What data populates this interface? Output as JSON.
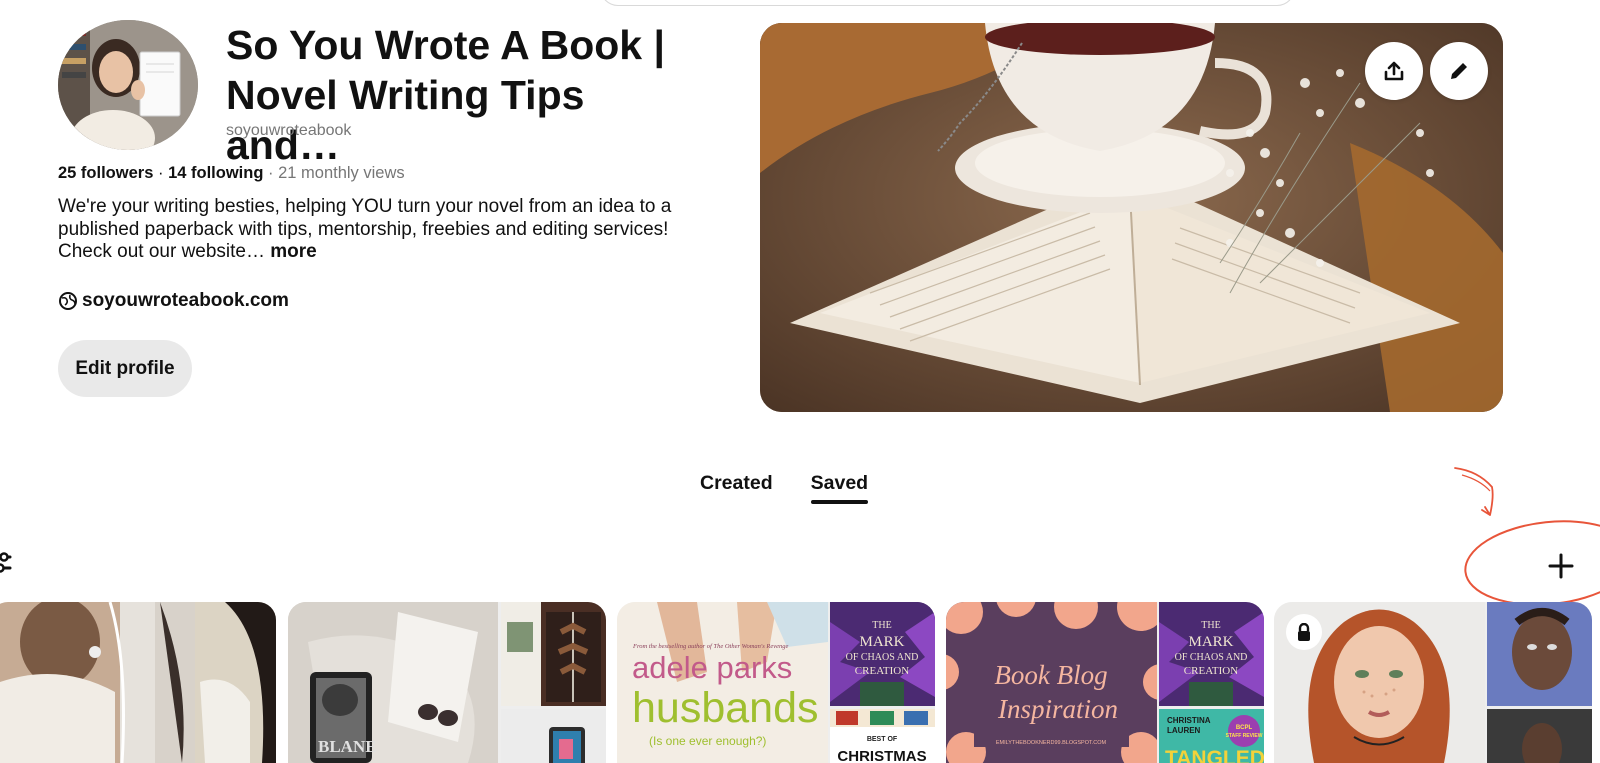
{
  "profile": {
    "name": "So You Wrote A Book | Novel Writing Tips and…",
    "username": "soyouwroteabook",
    "followers": "25 followers",
    "following": "14 following",
    "monthly_views": "21 monthly views",
    "bio": "We're your writing besties, helping YOU turn your novel from an idea to a published paperback with tips, mentorship, freebies and editing services! Check out our website…",
    "bio_more": "more",
    "website": "soyouwroteabook.com",
    "edit_label": "Edit profile"
  },
  "tabs": [
    {
      "label": "Created",
      "active": false
    },
    {
      "label": "Saved",
      "active": true
    }
  ],
  "board_text": {
    "husbands_author_line": "From the bestselling author of The Other Woman's Revenge",
    "husbands_author": "adele parks",
    "husbands_title": "husbands",
    "husbands_tagline": "(Is one ever enough?)",
    "blang": "BLANE",
    "mark_title": "THE MARK OF CHAOS AND CREATION",
    "best_of": "BEST OF",
    "christmas": "CHRISTMAS",
    "blog_title_1": "Book Blog",
    "blog_title_2": "Inspiration",
    "blog_url": "EMILYTHEBOOKNERD99.BLOGSPOT.COM",
    "christina": "CHRISTINA LAUREN",
    "tangled": "TANGLED",
    "staff_review": "BCPL STAFF REVIEW"
  },
  "icons": {
    "share": "share-icon",
    "edit": "pencil-icon",
    "globe": "globe-icon",
    "filter": "filter-icon",
    "add": "plus-icon",
    "lock": "lock-icon"
  },
  "colors": {
    "annotation": "#e8553a",
    "button_bg": "#e9e9e9",
    "muted_text": "#767676"
  }
}
